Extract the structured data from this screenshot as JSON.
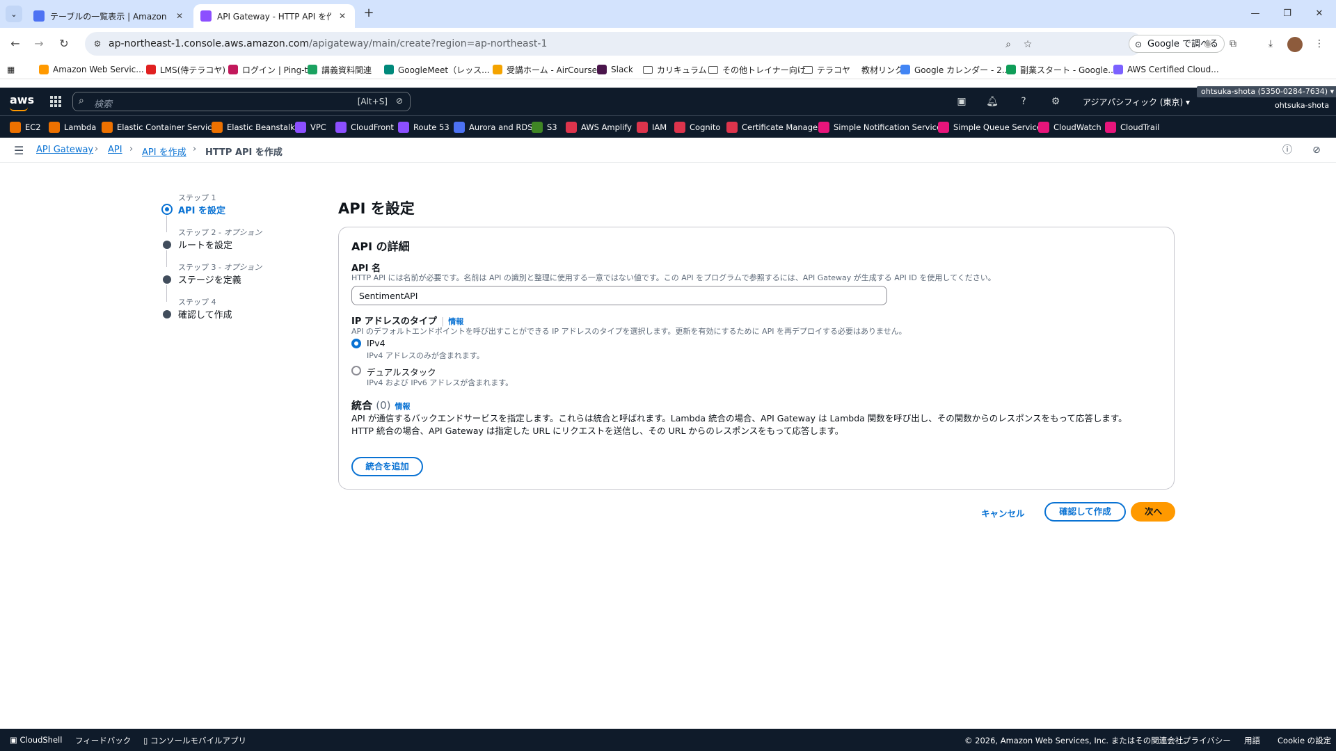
{
  "browser": {
    "tabs": [
      {
        "title": "テーブルの一覧表示 | Amazon Dy",
        "active": false
      },
      {
        "title": "API Gateway - HTTP API を作成",
        "active": true
      }
    ],
    "url_host": "ap-northeast-1.console.aws.amazon.com",
    "url_path": "/apigateway/main/create?region=ap-northeast-1",
    "google_search_label": "Google で調べる",
    "bookmarks": [
      {
        "label": "Amazon Web Servic...",
        "color": "#ff9900"
      },
      {
        "label": "LMS(侍テラコヤ)",
        "color": "#e02020"
      },
      {
        "label": "ログイン | Ping-t",
        "color": "#c2185b"
      },
      {
        "label": "講義資料関連",
        "color": "#1aa260"
      },
      {
        "label": "GoogleMeet（レッス...",
        "color": "#00897b"
      },
      {
        "label": "受講ホーム - AirCourse",
        "color": "#f4a300"
      },
      {
        "label": "Slack",
        "color": "#4a154b"
      },
      {
        "label": "カリキュラム",
        "folder": true
      },
      {
        "label": "その他トレイナー向け",
        "folder": true
      },
      {
        "label": "テラコヤ",
        "folder": true
      },
      {
        "label": "教材リンク",
        "folder": false,
        "plain": true
      },
      {
        "label": "Google カレンダー - 2...",
        "color": "#4285f4"
      },
      {
        "label": "副業スタート - Google...",
        "color": "#0f9d58"
      },
      {
        "label": "AWS Certified Cloud...",
        "color": "#7b61ff"
      }
    ]
  },
  "aws": {
    "search_placeholder": "検索",
    "search_shortcut": "[Alt+S]",
    "region": "アジアパシフィック (東京) ▾",
    "account_badge": "ohtsuka-shota (5350-0284-7634) ▾",
    "account_user": "ohtsuka-shota",
    "favorites": [
      {
        "label": "EC2",
        "color": "#ed7100"
      },
      {
        "label": "Lambda",
        "color": "#ed7100"
      },
      {
        "label": "Elastic Container Service",
        "color": "#ed7100"
      },
      {
        "label": "Elastic Beanstalk",
        "color": "#ed7100"
      },
      {
        "label": "VPC",
        "color": "#8c4fff"
      },
      {
        "label": "CloudFront",
        "color": "#8c4fff"
      },
      {
        "label": "Route 53",
        "color": "#8c4fff"
      },
      {
        "label": "Aurora and RDS",
        "color": "#4d72f3"
      },
      {
        "label": "S3",
        "color": "#3f8624"
      },
      {
        "label": "AWS Amplify",
        "color": "#dd344c"
      },
      {
        "label": "IAM",
        "color": "#dd344c"
      },
      {
        "label": "Cognito",
        "color": "#dd344c"
      },
      {
        "label": "Certificate Manager",
        "color": "#dd344c"
      },
      {
        "label": "Simple Notification Service",
        "color": "#e7157b"
      },
      {
        "label": "Simple Queue Service",
        "color": "#e7157b"
      },
      {
        "label": "CloudWatch",
        "color": "#e7157b"
      },
      {
        "label": "CloudTrail",
        "color": "#e7157b"
      }
    ]
  },
  "breadcrumb": {
    "items": [
      "API Gateway",
      "API",
      "API を作成"
    ],
    "current": "HTTP API を作成"
  },
  "steps": [
    {
      "num": "ステップ 1",
      "opt": "",
      "label": "API を設定",
      "active": true
    },
    {
      "num": "ステップ 2 - ",
      "opt": "オプション",
      "label": "ルートを設定",
      "active": false
    },
    {
      "num": "ステップ 3 - ",
      "opt": "オプション",
      "label": "ステージを定義",
      "active": false
    },
    {
      "num": "ステップ 4",
      "opt": "",
      "label": "確認して作成",
      "active": false
    }
  ],
  "main": {
    "title": "API を設定",
    "panel_title": "API の詳細",
    "api_name_label": "API 名",
    "api_name_desc": "HTTP API には名前が必要です。名前は API の識別と整理に使用する一意ではない値です。この API をプログラムで参照するには、API Gateway が生成する API ID を使用してください。",
    "api_name_value": "SentimentAPI",
    "ip_type_label": "IP アドレスのタイプ",
    "info": "情報",
    "ip_type_desc": "API のデフォルトエンドポイントを呼び出すことができる IP アドレスのタイプを選択します。更新を有効にするために API を再デプロイする必要はありません。",
    "ip_options": [
      {
        "label": "IPv4",
        "desc": "IPv4 アドレスのみが含まれます。",
        "selected": true
      },
      {
        "label": "デュアルスタック",
        "desc": "IPv4 および IPv6 アドレスが含まれます。",
        "selected": false
      }
    ],
    "integration_title": "統合",
    "integration_count": "(0)",
    "integration_desc_1": "API が通信するバックエンドサービスを指定します。これらは統合と呼ばれます。Lambda 統合の場合、API Gateway は Lambda 関数を呼び出し、その関数からのレスポンスをもって応答します。",
    "integration_desc_2": "HTTP 統合の場合、API Gateway は指定した URL にリクエストを送信し、その URL からのレスポンスをもって応答します。",
    "add_integration": "統合を追加",
    "cancel": "キャンセル",
    "review_create": "確認して作成",
    "next": "次へ"
  },
  "footer": {
    "cloudshell": "CloudShell",
    "feedback": "フィードバック",
    "mobile_app": "コンソールモバイルアプリ",
    "copyright": "© 2026, Amazon Web Services, Inc. またはその関連会社。",
    "privacy": "プライバシー",
    "terms": "用語",
    "cookie": "Cookie の設定"
  }
}
